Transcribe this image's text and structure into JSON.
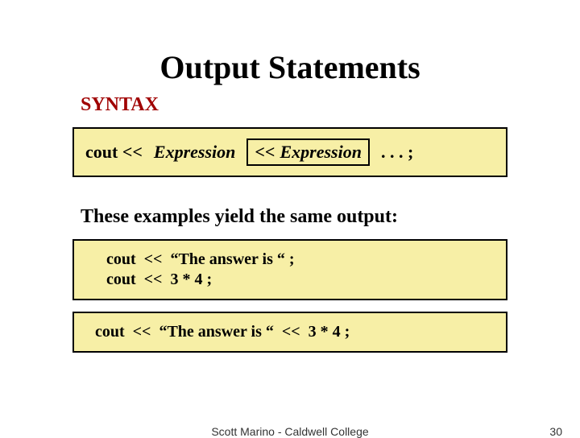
{
  "title": "Output Statements",
  "syntax_label": "SYNTAX",
  "syntax": {
    "prefix_plain": "cout  <<",
    "prefix_italic": "Expression",
    "inner_plain": "<<",
    "inner_italic": "Expression",
    "suffix": " . . . ;"
  },
  "examples_intro": "These examples yield the same output:",
  "box1": {
    "line1": "cout  <<  “The answer is “ ;",
    "line2": "cout  <<  3 * 4 ;"
  },
  "box2": {
    "line1": "cout  <<  “The answer is “  <<  3 * 4 ;"
  },
  "footer": {
    "author": "Scott Marino - Caldwell College",
    "page": "30"
  }
}
